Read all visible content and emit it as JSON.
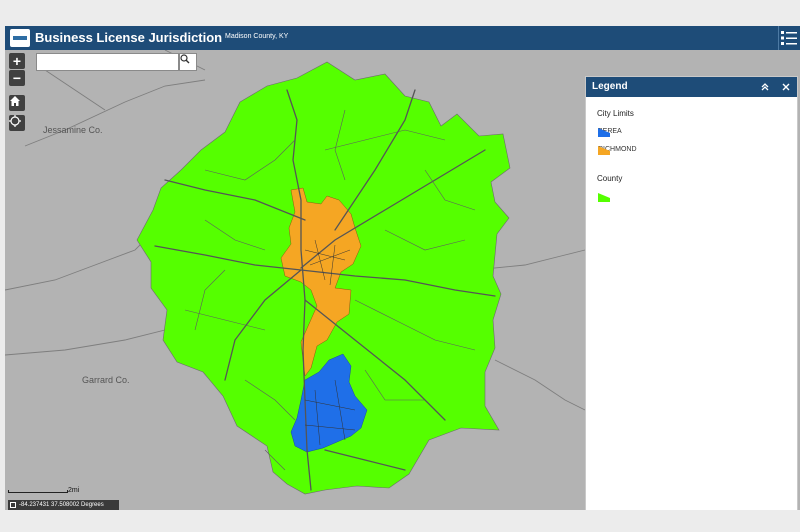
{
  "header": {
    "title": "Business License Jurisdiction",
    "subtitle": "Madison County, KY"
  },
  "search": {
    "placeholder": ""
  },
  "map": {
    "county_labels": [
      "Jessamine Co.",
      "Garrard Co."
    ],
    "colors": {
      "county": "#55ff00",
      "richmond": "#f5a623",
      "berea": "#1f6fe8",
      "roads": "#555555",
      "boundary": "#7e7e7e",
      "background": "#b3b3b3"
    }
  },
  "scalebar": {
    "label": "2mi"
  },
  "coordinates": {
    "text": "-84.237431 37.508002 Degrees"
  },
  "legend": {
    "title": "Legend",
    "groups": [
      {
        "name": "City Limits",
        "items": [
          {
            "label": "BEREA",
            "color": "#1f6fe8"
          },
          {
            "label": "RICHMOND",
            "color": "#f5a623"
          }
        ]
      },
      {
        "name": "County",
        "items": [
          {
            "label": "",
            "color": "#55ff00"
          }
        ]
      }
    ]
  },
  "icons": [
    "logo-icon",
    "layer-list-icon",
    "zoom-in-icon",
    "zoom-out-icon",
    "home-icon",
    "locate-icon",
    "search-icon",
    "collapse-icon",
    "close-icon"
  ]
}
